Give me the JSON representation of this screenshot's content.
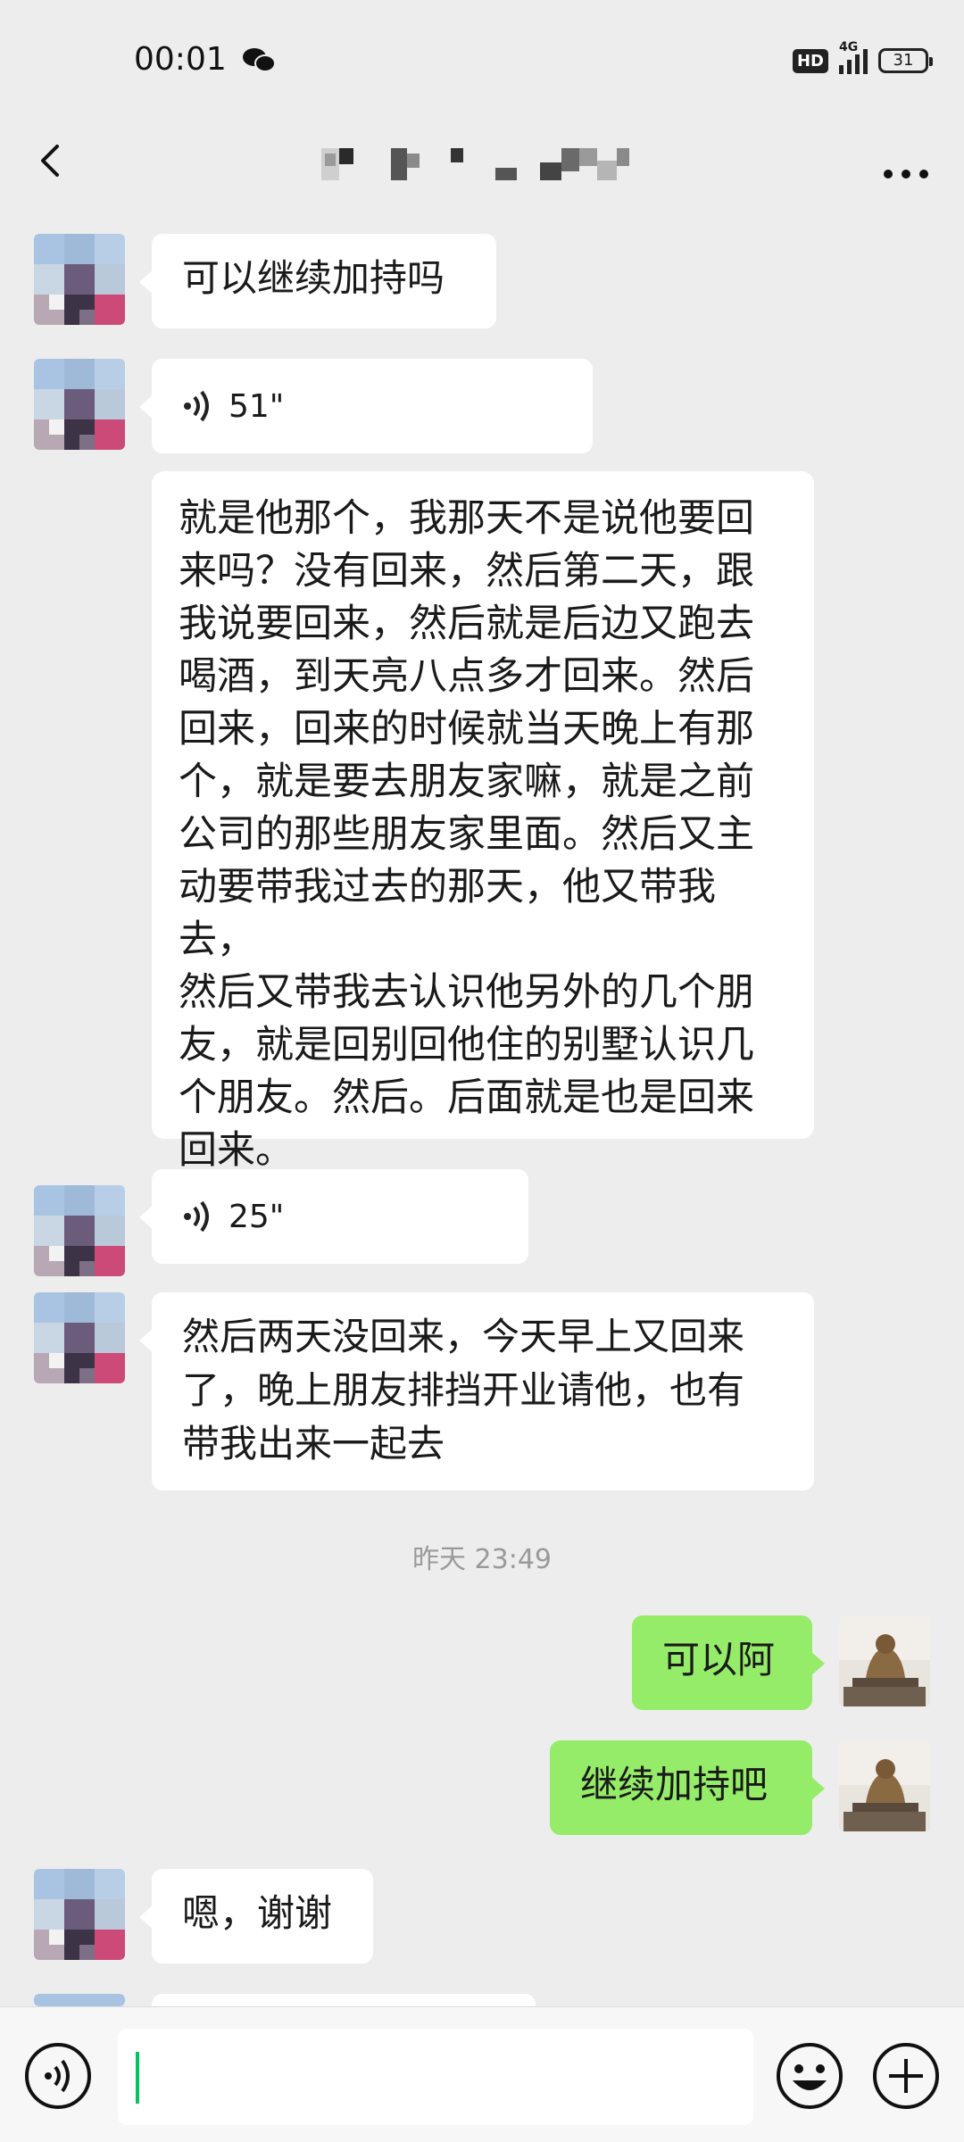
{
  "status_bar": {
    "time": "00:01",
    "hd_label": "HD",
    "network": "4G",
    "battery": "31"
  },
  "nav": {
    "title": ""
  },
  "messages": [
    {
      "text": "可以继续加持吗"
    },
    {
      "duration": "51\""
    },
    {
      "transcript": "就是他那个，我那天不是说他要回\n来吗？没有回来，然后第二天，跟\n我说要回来，然后就是后边又跑去\n喝酒，到天亮八点多才回来。然后\n回来，回来的时候就当天晚上有那\n个，就是要去朋友家嘛，就是之前\n公司的那些朋友家里面。然后又主\n动要带我过去的那天，他又带我去，\n然后又带我去认识他另外的几个朋\n友，就是回别回他住的别墅认识几\n个朋友。然后。后面就是也是回来\n回来。"
    },
    {
      "duration": "25\""
    },
    {
      "text": "然后两天没回来，今天早上又回来\n了，晚上朋友排挡开业请他，也有\n带我出来一起去"
    },
    {
      "timestamp": "昨天 23:49"
    },
    {
      "text": "可以阿"
    },
    {
      "text": "继续加持吧"
    },
    {
      "text": "嗯，谢谢"
    }
  ],
  "input": {
    "value": ""
  },
  "colors": {
    "background": "#ededed",
    "own_bubble": "#95ec69",
    "other_bubble": "#ffffff",
    "accent": "#07c160"
  },
  "icons": [
    "wechat-icon",
    "back-arrow-icon",
    "more-dots-icon",
    "voice-wave-icon",
    "voice-input-icon",
    "emoji-icon",
    "plus-icon"
  ]
}
